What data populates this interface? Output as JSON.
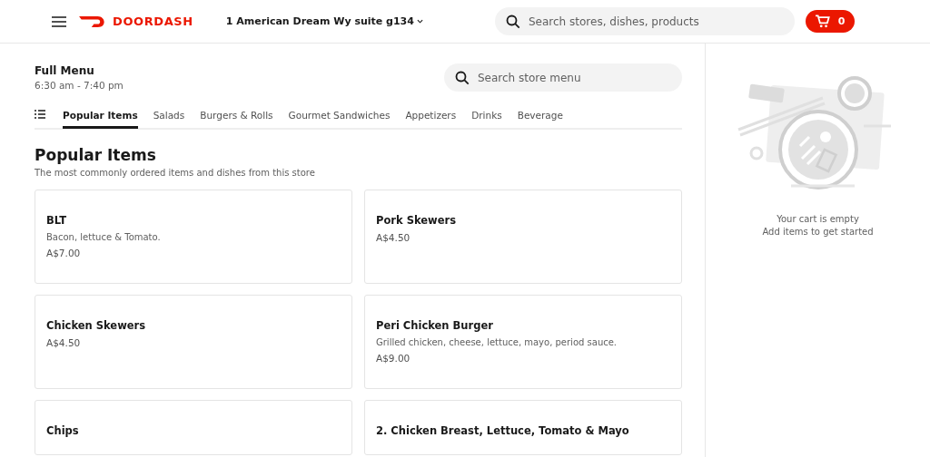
{
  "header": {
    "logo_text": "DOORDASH",
    "address": "1 American Dream Wy suite g134",
    "search": {
      "placeholder": "Search stores, dishes, products"
    },
    "cart_count": "0"
  },
  "menu": {
    "title": "Full Menu",
    "hours": "6:30 am - 7:40 pm",
    "search": {
      "placeholder": "Search store menu"
    }
  },
  "tabs": [
    {
      "label": "Popular Items",
      "selected": true
    },
    {
      "label": "Salads",
      "selected": false
    },
    {
      "label": "Burgers & Rolls",
      "selected": false
    },
    {
      "label": "Gourmet Sandwiches",
      "selected": false
    },
    {
      "label": "Appetizers",
      "selected": false
    },
    {
      "label": "Drinks",
      "selected": false
    },
    {
      "label": "Beverage",
      "selected": false
    }
  ],
  "section": {
    "title": "Popular Items",
    "subtitle": "The most commonly ordered items and dishes from this store"
  },
  "items": [
    {
      "name": "BLT",
      "description": "Bacon, lettuce & Tomato.",
      "price": "A$7.00"
    },
    {
      "name": "Pork Skewers",
      "price": "A$4.50"
    },
    {
      "name": "Chicken Skewers",
      "price": "A$4.50"
    },
    {
      "name": "Peri Chicken Burger",
      "description": "Grilled chicken, cheese, lettuce, mayo, period sauce.",
      "price": "A$9.00"
    },
    {
      "name": "Chips"
    },
    {
      "name": "2. Chicken Breast, Lettuce, Tomato & Mayo"
    }
  ],
  "cart": {
    "empty_title": "Your cart is empty",
    "empty_hint": "Add items to get started"
  }
}
